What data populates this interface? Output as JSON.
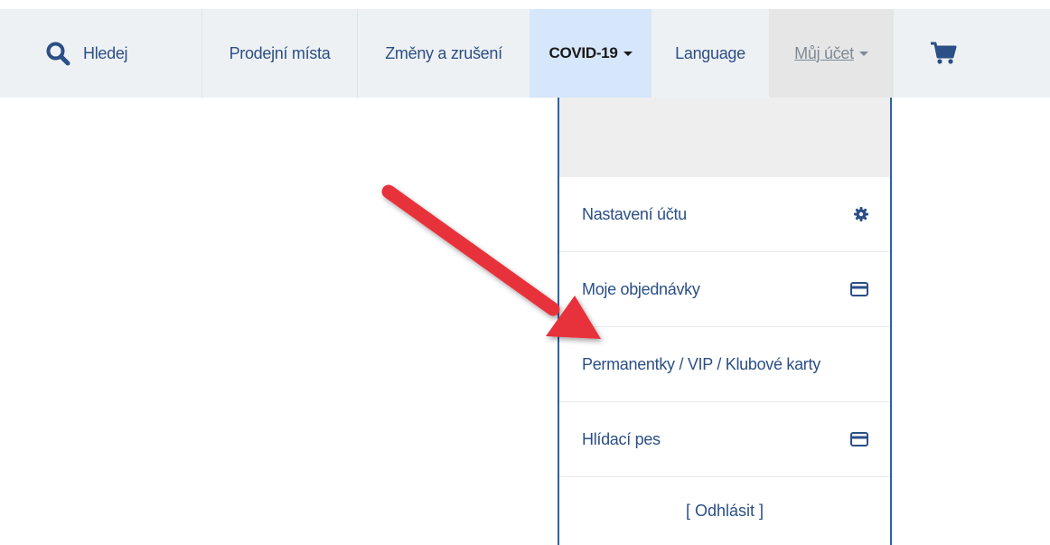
{
  "nav": {
    "search_label": "Hledej",
    "prodejni_label": "Prodejní místa",
    "zmeny_label": "Změny a zrušení",
    "covid_label": "COVID-19",
    "language_label": "Language",
    "account_label": "Můj účet"
  },
  "dropdown": {
    "items": [
      {
        "label": "Nastavení účtu",
        "icon": "gear-icon"
      },
      {
        "label": "Moje objednávky",
        "icon": "credit-card-icon"
      },
      {
        "label": "Permanentky / VIP / Klubové karty"
      },
      {
        "label": "Hlídací pes",
        "icon": "credit-card-icon"
      }
    ],
    "logout_label": "[ Odhlásit ]"
  },
  "colors": {
    "link": "#2b4f86",
    "nav_bg": "#eef1f3",
    "covid_bg": "#d6e6fb",
    "account_bg": "#e6e6e6",
    "dropdown_border": "#2b63a8",
    "arrow": "#e8303a"
  }
}
